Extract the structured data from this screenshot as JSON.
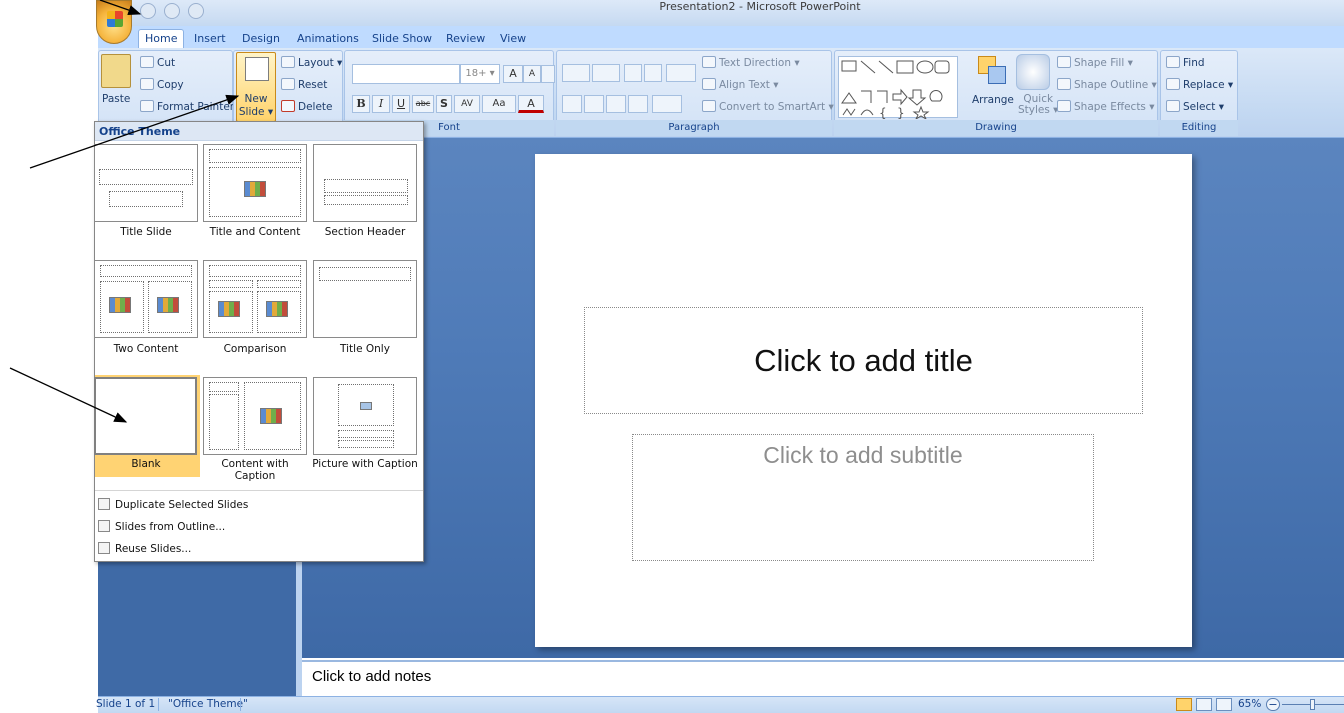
{
  "window": {
    "title": "Presentation2 - Microsoft PowerPoint"
  },
  "tabs": [
    "Home",
    "Insert",
    "Design",
    "Animations",
    "Slide Show",
    "Review",
    "View"
  ],
  "clipboard": {
    "paste": "Paste",
    "cut": "Cut",
    "copy": "Copy",
    "format_painter": "Format Painter"
  },
  "slides_group": {
    "new_slide_line1": "New",
    "new_slide_line2": "Slide ▾",
    "layout": "Layout ▾",
    "reset": "Reset",
    "delete": "Delete"
  },
  "font": {
    "size": "18+ ▾",
    "grow": "A",
    "shrink": "A",
    "bold": "B",
    "italic": "I",
    "underline": "U",
    "strike": "abc",
    "shadow": "S",
    "spacing": "AV",
    "case": "Aa",
    "color": "A",
    "label": "Font"
  },
  "paragraph": {
    "text_direction": "Text Direction ▾",
    "align_text": "Align Text ▾",
    "convert_smartart": "Convert to SmartArt ▾",
    "label": "Paragraph"
  },
  "drawing": {
    "arrange": "Arrange",
    "quick_styles_line1": "Quick",
    "quick_styles_line2": "Styles ▾",
    "shape_fill": "Shape Fill ▾",
    "shape_outline": "Shape Outline ▾",
    "shape_effects": "Shape Effects ▾",
    "label": "Drawing"
  },
  "editing": {
    "find": "Find",
    "replace": "Replace ▾",
    "select": "Select ▾",
    "label": "Editing"
  },
  "gallery": {
    "header": "Office Theme",
    "layouts": [
      "Title Slide",
      "Title and Content",
      "Section Header",
      "Two Content",
      "Comparison",
      "Title Only",
      "Blank",
      "Content with Caption",
      "Picture with Caption"
    ],
    "selected": "Blank",
    "menu": [
      "Duplicate Selected Slides",
      "Slides from Outline...",
      "Reuse Slides..."
    ]
  },
  "slide": {
    "title_placeholder": "Click to add title",
    "subtitle_placeholder": "Click to add subtitle"
  },
  "notes": {
    "placeholder": "Click to add notes"
  },
  "status": {
    "slide_info": "Slide 1 of 1",
    "theme": "\"Office Theme\"",
    "zoom": "65%"
  }
}
